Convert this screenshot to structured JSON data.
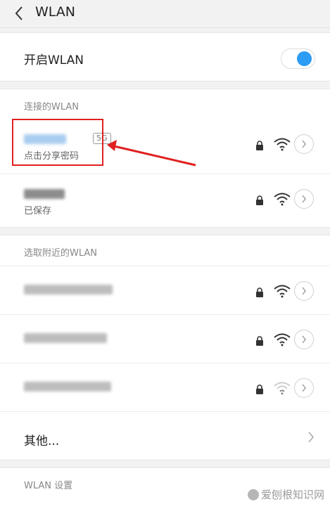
{
  "header": {
    "title": "WLAN",
    "back_icon": "chevron-left-icon"
  },
  "wlan_toggle": {
    "label": "开启WLAN",
    "on": true,
    "color": "#2c9cf5"
  },
  "connected_section": {
    "label": "连接的WLAN",
    "networks": [
      {
        "band": "5G",
        "status": "点击分享密码",
        "secured": true,
        "signal": "full",
        "highlighted": true
      },
      {
        "status": "已保存",
        "secured": true,
        "signal": "full"
      }
    ]
  },
  "nearby_section": {
    "label": "选取附近的WLAN",
    "networks": [
      {
        "secured": true,
        "signal": "full"
      },
      {
        "secured": true,
        "signal": "full"
      },
      {
        "secured": true,
        "signal": "weak"
      }
    ],
    "other": {
      "label": "其他..."
    }
  },
  "settings_section": {
    "label": "WLAN 设置"
  },
  "watermark": {
    "text": "爱刨根知识网"
  },
  "annotation": {
    "color": "#e02020"
  }
}
